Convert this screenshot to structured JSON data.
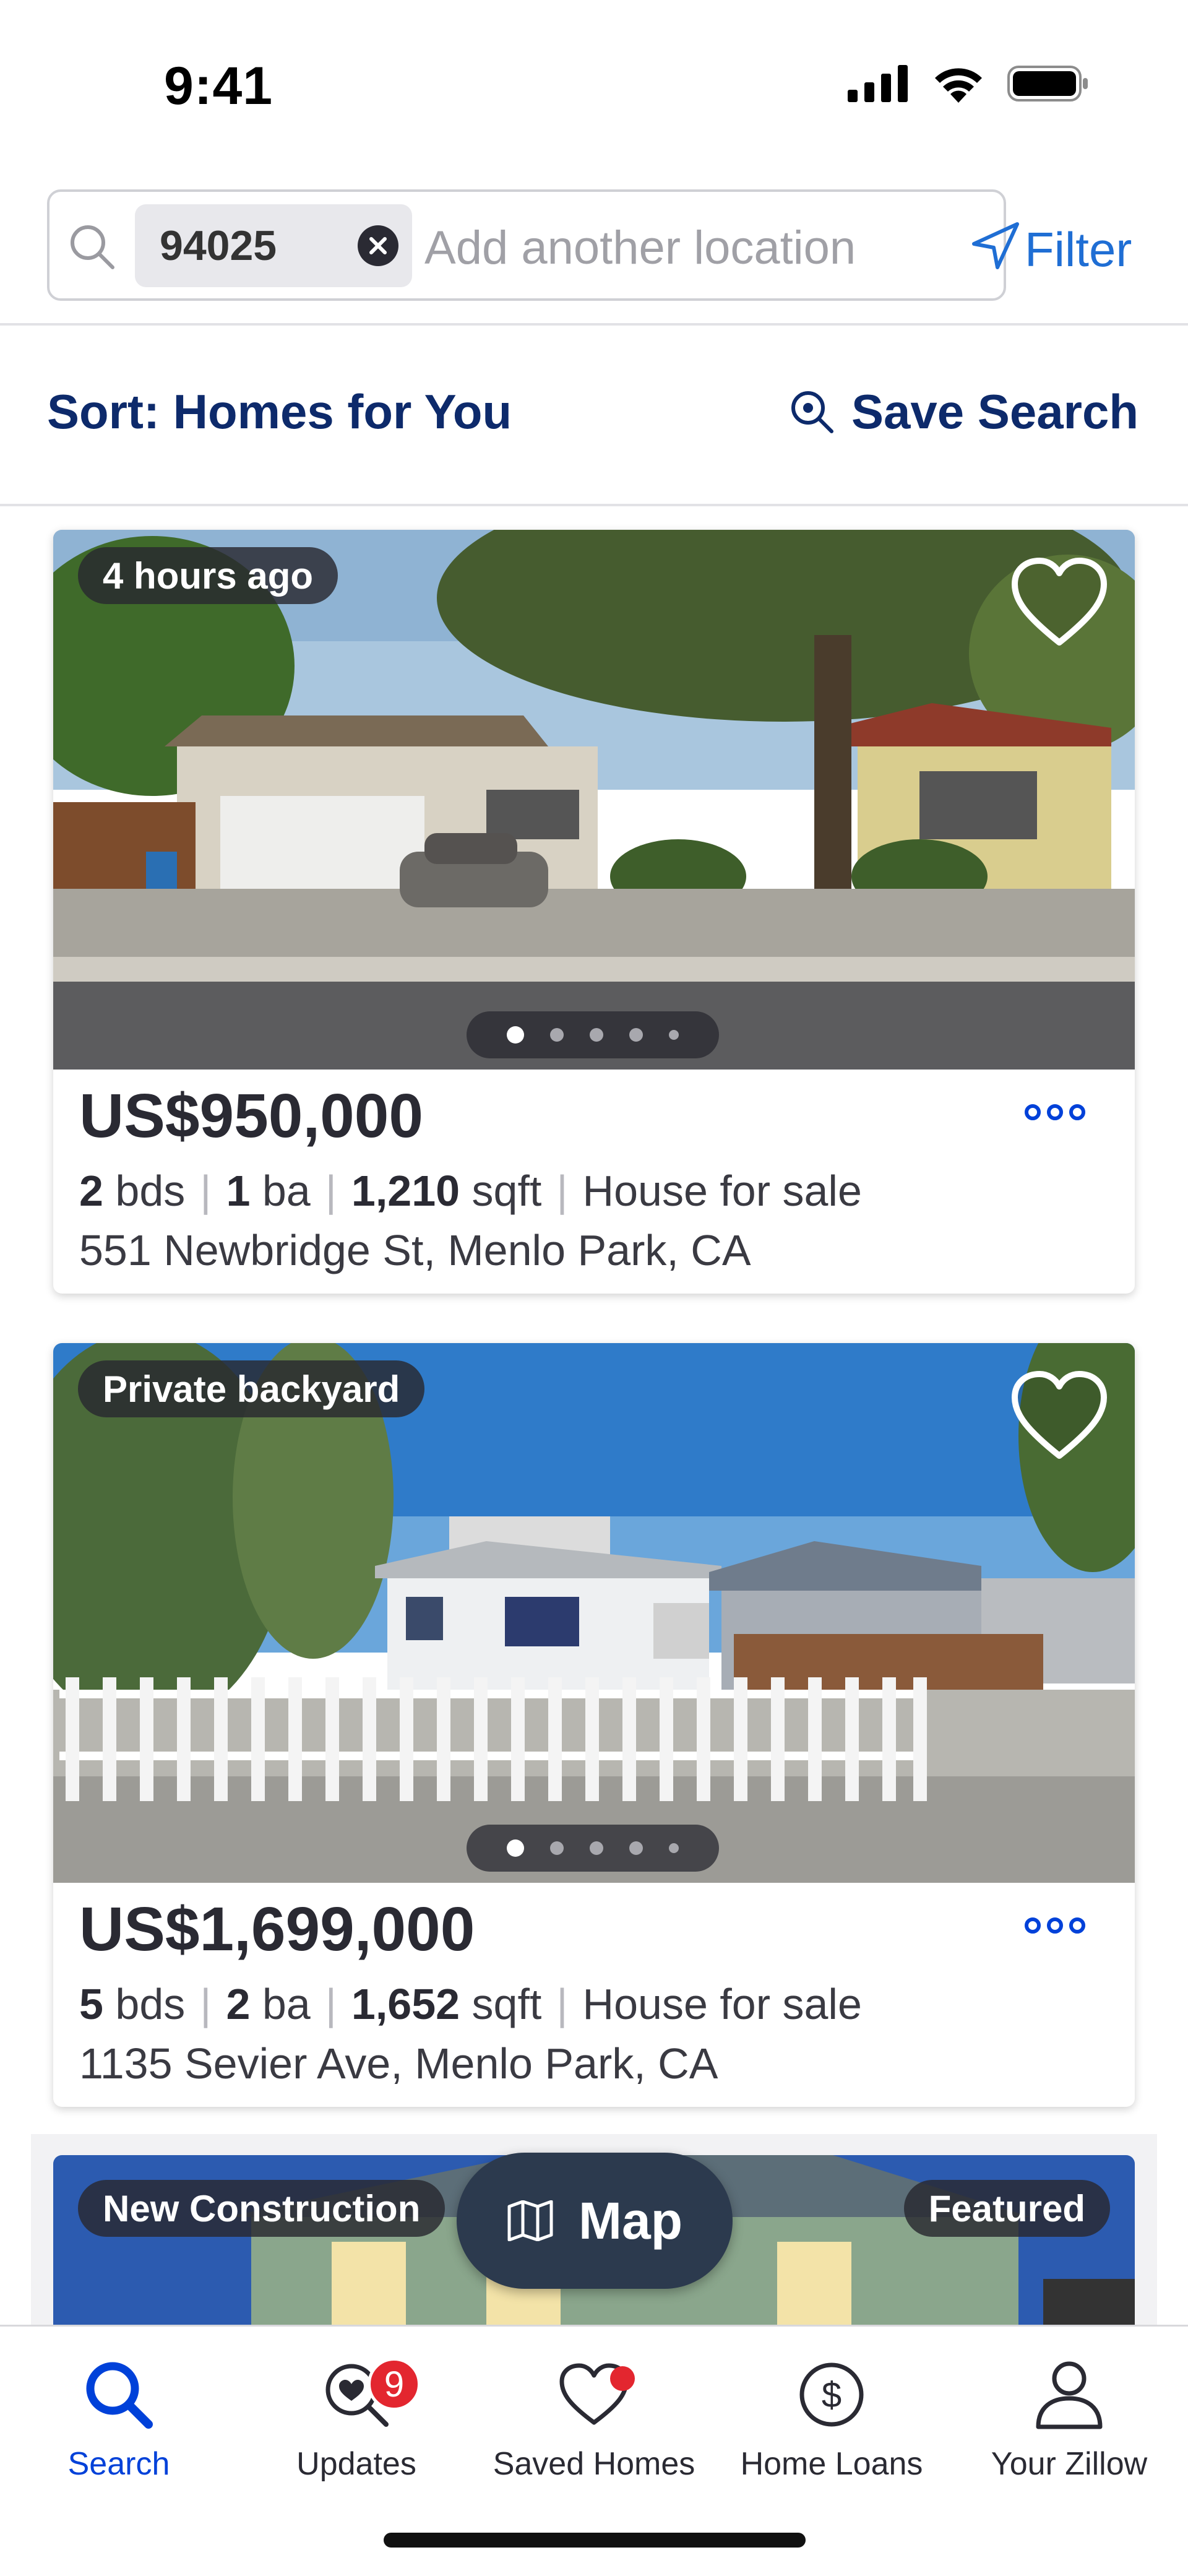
{
  "status_bar": {
    "time": "9:41"
  },
  "search": {
    "chip_label": "94025",
    "placeholder": "Add another location",
    "filter_label": "Filter"
  },
  "sort": {
    "label": "Sort: Homes for You",
    "save_search_label": "Save Search"
  },
  "listings": [
    {
      "tag": "4 hours ago",
      "price": "US$950,000",
      "beds": "2",
      "beds_unit": "bds",
      "baths": "1",
      "baths_unit": "ba",
      "sqft": "1,210",
      "sqft_unit": "sqft",
      "type": "House for sale",
      "address": "551 Newbridge St, Menlo Park, CA",
      "photo_count": 5,
      "active_photo": 1
    },
    {
      "tag": "Private backyard",
      "price": "US$1,699,000",
      "beds": "5",
      "beds_unit": "bds",
      "baths": "2",
      "baths_unit": "ba",
      "sqft": "1,652",
      "sqft_unit": "sqft",
      "type": "House for sale",
      "address": "1135 Sevier Ave, Menlo Park, CA",
      "photo_count": 5,
      "active_photo": 1
    },
    {
      "tag": "New Construction",
      "tag_right": "Featured"
    }
  ],
  "map_button": {
    "label": "Map"
  },
  "bottom_nav": {
    "items": [
      {
        "label": "Search",
        "icon": "search-icon",
        "active": true
      },
      {
        "label": "Updates",
        "icon": "updates-icon",
        "badge": "9"
      },
      {
        "label": "Saved Homes",
        "icon": "heart-icon",
        "dot": true
      },
      {
        "label": "Home Loans",
        "icon": "dollar-icon"
      },
      {
        "label": "Your Zillow",
        "icon": "person-icon"
      }
    ]
  },
  "colors": {
    "accent_blue": "#0041d9",
    "heading_navy": "#0d2a6b",
    "badge_red": "#e3262f"
  }
}
